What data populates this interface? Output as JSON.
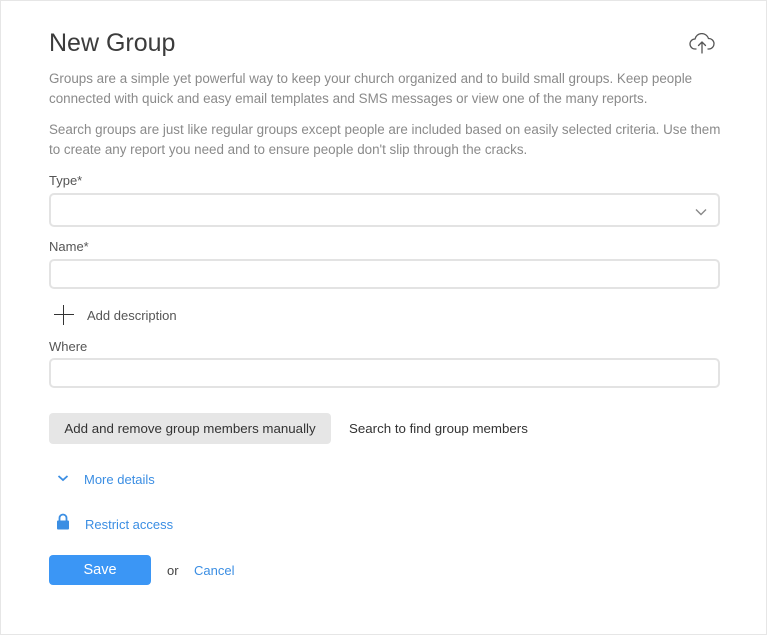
{
  "header": {
    "title": "New Group",
    "upload_icon": "cloud-upload-icon"
  },
  "descriptions": {
    "groups": "Groups are a simple yet powerful way to keep your church organized and to build small groups. Keep people connected with quick and easy email templates and SMS messages or view one of the many reports.",
    "search_groups": "Search groups are just like regular groups except people are included based on easily selected criteria. Use them to create any report you need and to ensure people don't slip through the cracks."
  },
  "form": {
    "type": {
      "label": "Type*",
      "value": "",
      "icon": "chevron-down-icon"
    },
    "name": {
      "label": "Name*",
      "value": ""
    },
    "add_description": {
      "label": "Add description",
      "icon": "plus-icon"
    },
    "where": {
      "label": "Where",
      "value": ""
    }
  },
  "member_modes": {
    "manual": {
      "label": "Add and remove group members manually",
      "selected": true
    },
    "search": {
      "label": "Search to find group members",
      "selected": false
    }
  },
  "links": {
    "more_details": {
      "label": "More details",
      "icon": "chevron-down-icon"
    },
    "restrict_access": {
      "label": "Restrict access",
      "icon": "lock-icon"
    }
  },
  "actions": {
    "save": "Save",
    "or": "or",
    "cancel": "Cancel"
  },
  "colors": {
    "accent": "#3b96f5",
    "link": "#3b8ee3",
    "selected_tab_bg": "#e6e6e6",
    "field_border": "#e3e3e3"
  }
}
